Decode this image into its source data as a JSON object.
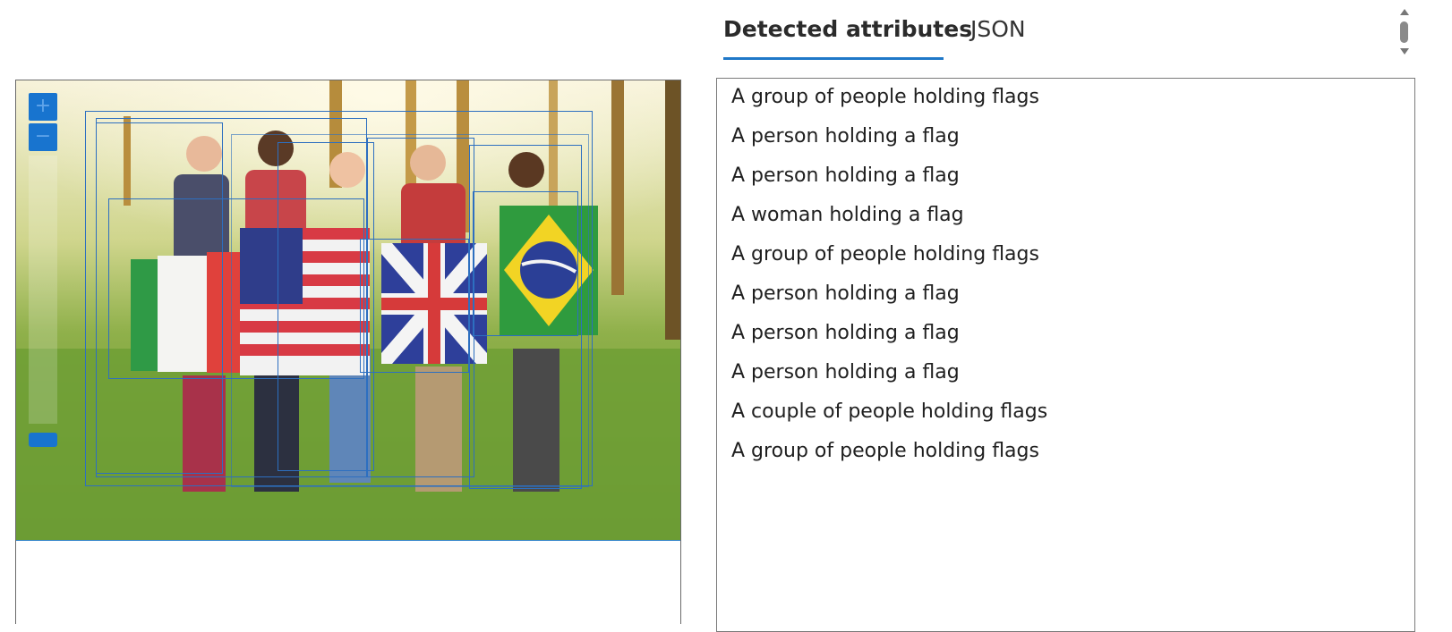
{
  "tabs": [
    {
      "label": "Detected attributes",
      "active": true
    },
    {
      "label": "JSON",
      "active": false
    }
  ],
  "zoom": {
    "in_label": "+",
    "out_label": "−"
  },
  "results": [
    "A group of people holding flags",
    "A person holding a flag",
    "A person holding a flag",
    "A woman holding a flag",
    "A group of people holding flags",
    "A person holding a flag",
    "A person holding a flag",
    "A person holding a flag",
    "A couple of people holding flags",
    "A group of people holding flags"
  ],
  "colors": {
    "accent": "#1f78c8",
    "box": "#2d6fc0",
    "zoom_button": "#1874cf"
  },
  "icons": [
    "scroll-up-arrow-icon",
    "scroll-down-arrow-icon",
    "zoom-in-icon",
    "zoom-out-icon"
  ]
}
